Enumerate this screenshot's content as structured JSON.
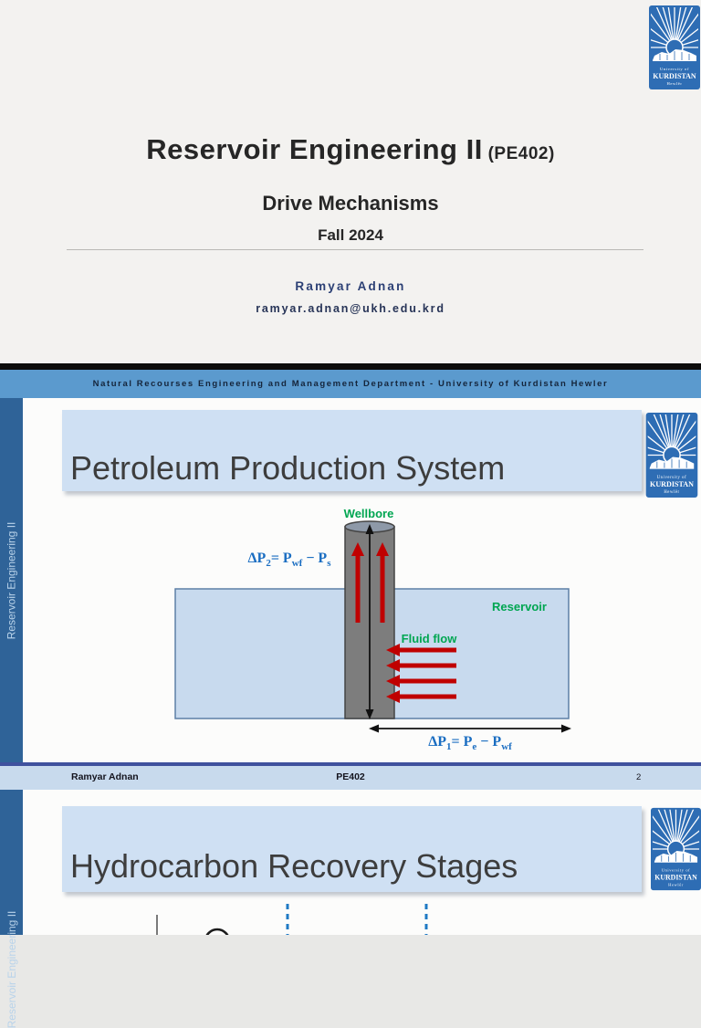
{
  "slide1": {
    "title": "Reservoir Engineering II",
    "title_suffix": " (PE402)",
    "subtitle": "Drive Mechanisms",
    "term": "Fall 2024",
    "author": "Ramyar Adnan",
    "email": "ramyar.adnan@ukh.edu.krd"
  },
  "logo": {
    "line1": "University of",
    "line2": "KURDISTAN",
    "line3": "Hewlêr"
  },
  "department_bar": "Natural Recourses Engineering and Management Department - University of Kurdistan Hewler",
  "sidebar_text": "Reservoir Engineering II",
  "slide2": {
    "title": "Petroleum Production System",
    "labels": {
      "wellbore": "Wellbore",
      "reservoir": "Reservoir",
      "fluid_flow": "Fluid flow"
    },
    "dp2": {
      "a": "ΔP",
      "a_sub": "2",
      "b": "= P",
      "b_sub": "wf",
      "c": " − P",
      "c_sub": "s"
    },
    "dp1": {
      "a": "ΔP",
      "a_sub": "1",
      "b": "= P",
      "b_sub": "e",
      "c": " − P",
      "c_sub": "wf"
    }
  },
  "footer": {
    "left": "Ramyar Adnan",
    "center": "PE402",
    "page": "2"
  },
  "slide3": {
    "title": "Hydrocarbon Recovery Stages"
  },
  "colors": {
    "accent_blue": "#5b9ace",
    "sidebar_blue": "#2f6398",
    "banner_blue": "#cfe0f3",
    "reservoir_fill": "#c8daee",
    "formula_blue": "#1b6ec2",
    "label_green": "#00a651",
    "arrow_red": "#c00000",
    "navy_line": "#3f519e"
  }
}
